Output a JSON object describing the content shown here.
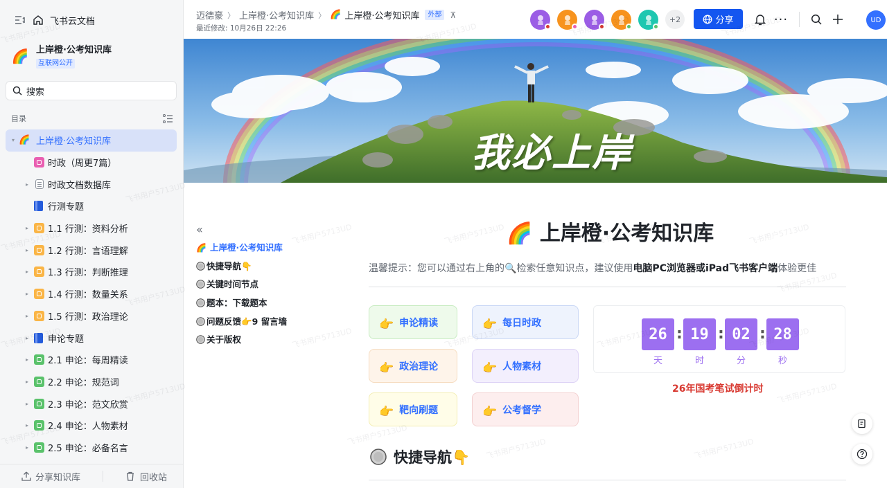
{
  "sidebar": {
    "app_title": "飞书云文档",
    "kb_name": "上岸橙·公考知识库",
    "kb_badge": "互联网公开",
    "search_placeholder": "搜索",
    "toc_title": "目录",
    "tree": [
      {
        "label": "上岸橙·公考知识库",
        "icon": "rainbow-icon",
        "level": 0,
        "arrow": "▾",
        "active": true
      },
      {
        "label": "时政（周更7篇）",
        "icon": "pink-doc-icon",
        "color": "#e95fb1",
        "level": 1,
        "arrow": ""
      },
      {
        "label": "时政文档数据库",
        "icon": "doc-icon",
        "color": "#8f959e",
        "level": 1,
        "arrow": "▸"
      },
      {
        "label": "行测专题",
        "icon": "book-icon",
        "color": "#245bdb",
        "level": 1,
        "arrow": ""
      },
      {
        "label": "1.1 行测：资料分析",
        "icon": "folder-icon",
        "color": "#fab546",
        "level": 1,
        "arrow": "▸"
      },
      {
        "label": "1.2 行测：言语理解",
        "icon": "folder-icon",
        "color": "#fab546",
        "level": 1,
        "arrow": "▸"
      },
      {
        "label": "1.3 行测：判断推理",
        "icon": "folder-icon",
        "color": "#fab546",
        "level": 1,
        "arrow": "▸"
      },
      {
        "label": "1.4 行测：数量关系",
        "icon": "folder-icon",
        "color": "#fab546",
        "level": 1,
        "arrow": "▸"
      },
      {
        "label": "1.5 行测：政治理论",
        "icon": "folder-icon",
        "color": "#fab546",
        "level": 1,
        "arrow": "▸"
      },
      {
        "label": "申论专题",
        "icon": "book-icon",
        "color": "#245bdb",
        "level": 1,
        "arrow": "▸"
      },
      {
        "label": "2.1 申论：每周精读",
        "icon": "folder-icon",
        "color": "#5ac26b",
        "level": 1,
        "arrow": "▸"
      },
      {
        "label": "2.2 申论：规范词",
        "icon": "folder-icon",
        "color": "#5ac26b",
        "level": 1,
        "arrow": "▸"
      },
      {
        "label": "2.3 申论：范文欣赏",
        "icon": "folder-icon",
        "color": "#5ac26b",
        "level": 1,
        "arrow": "▸"
      },
      {
        "label": "2.4 申论：人物素材",
        "icon": "folder-icon",
        "color": "#5ac26b",
        "level": 1,
        "arrow": "▸"
      },
      {
        "label": "2.5 申论：必备名言",
        "icon": "folder-icon",
        "color": "#5ac26b",
        "level": 1,
        "arrow": "▸"
      }
    ],
    "share_kb": "分享知识库",
    "trash": "回收站"
  },
  "header": {
    "crumbs": [
      "迈德豪",
      "上岸橙·公考知识库",
      "上岸橙·公考知识库"
    ],
    "external_tag": "外部",
    "modified": "最近修改: 10月26日 22:26",
    "avatars": [
      {
        "color": "#9b5de5",
        "dot": "#d83931"
      },
      {
        "color": "#f7931e",
        "dot": "#e95fb1"
      },
      {
        "color": "#9b5de5",
        "dot": "#d83931"
      },
      {
        "color": "#f7931e",
        "dot": "#5ac26b"
      },
      {
        "color": "#1fc7b0",
        "dot": "#5ac26b"
      }
    ],
    "more_count": "+2",
    "share_label": "分享",
    "me_initials": "UD"
  },
  "banner": {
    "text": "我必上岸"
  },
  "outline": {
    "items": [
      "上岸橙·公考知识库",
      "快捷导航👇",
      "关键时间节点",
      "题本：下载题本",
      "问题反馈👉9 留言墙",
      "关于版权"
    ]
  },
  "content": {
    "title": "上岸橙·公考知识库",
    "tip_pre": "温馨提示：您可以通过右上角的",
    "tip_mid": "检索任意知识点，建议使用",
    "tip_bold": "电脑PC浏览器或iPad飞书客户端",
    "tip_post": "体验更佳",
    "cards": [
      {
        "label": "申论精读",
        "bg": "#eefaeb",
        "border": "#c8ecc2"
      },
      {
        "label": "每日时政",
        "bg": "#eef3fd",
        "border": "#c9d7f5"
      },
      {
        "label": "政治理论",
        "bg": "#fef4ea",
        "border": "#f6dcc0"
      },
      {
        "label": "人物素材",
        "bg": "#f3effd",
        "border": "#ddd3f6"
      },
      {
        "label": "靶向刷题",
        "bg": "#fffde8",
        "border": "#f3eeb4"
      },
      {
        "label": "公考督学",
        "bg": "#fdeeee",
        "border": "#f3d0d0"
      }
    ],
    "countdown": {
      "values": [
        "26",
        "19",
        "02",
        "28"
      ],
      "labels": [
        "天",
        "时",
        "分",
        "秒"
      ],
      "caption": "26年国考笔试倒计时"
    },
    "section_title": "快捷导航👇"
  },
  "watermark": "飞书用户5713UD"
}
